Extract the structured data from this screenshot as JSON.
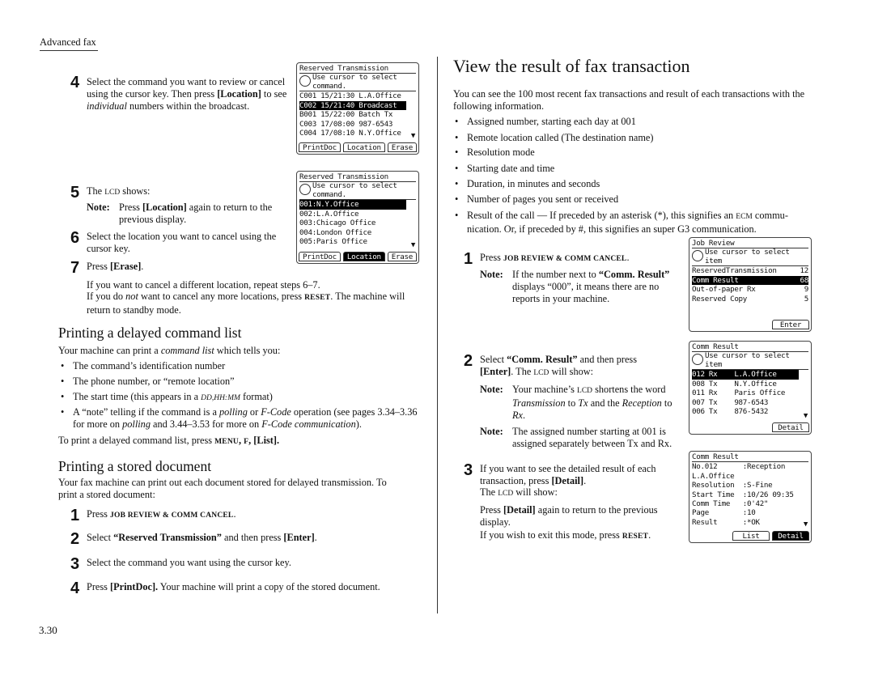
{
  "header": {
    "section": "Advanced fax",
    "page_number": "3.30"
  },
  "left": {
    "step4": {
      "num": "4",
      "text": [
        [
          "Select the command you want to review or can­cel using the cursor key. Then press ",
          ""
        ],
        [
          "[Location]",
          "b"
        ],
        [
          " to see ",
          ""
        ],
        [
          "individual",
          "i"
        ],
        [
          " numbers within the broad­cast.",
          ""
        ]
      ]
    },
    "step5": {
      "num": "5",
      "text": [
        [
          "The ",
          ""
        ],
        [
          "LCD",
          "scn"
        ],
        [
          " shows:",
          ""
        ]
      ]
    },
    "note5": {
      "label": "Note:",
      "text": [
        [
          "Press ",
          ""
        ],
        [
          "[Location]",
          "b"
        ],
        [
          " again to return to the previous display.",
          ""
        ]
      ]
    },
    "step6": {
      "num": "6",
      "text": [
        [
          "Select the location you want to cancel using the cursor key.",
          ""
        ]
      ]
    },
    "step7": {
      "num": "7",
      "text": [
        [
          "Press ",
          ""
        ],
        [
          "[Erase]",
          "b"
        ],
        [
          ".",
          ""
        ]
      ]
    },
    "after7": [
      [
        [
          "If you want to cancel a different location, repeat steps 6–7.",
          ""
        ]
      ],
      [
        [
          "If you do ",
          ""
        ],
        [
          "not",
          "i"
        ],
        [
          " want to cancel any more locations, press ",
          ""
        ],
        [
          "RESET",
          "sc"
        ],
        [
          ". The machine will return to standby mode.",
          ""
        ]
      ]
    ],
    "sec1": {
      "heading": "Printing a delayed command list",
      "intro": [
        [
          "Your machine can print a ",
          ""
        ],
        [
          "command list",
          "i"
        ],
        [
          " which tells you:",
          ""
        ]
      ],
      "bullets": [
        [
          [
            "The command’s identification number",
            ""
          ]
        ],
        [
          [
            "The phone number, or “remote location”",
            ""
          ]
        ],
        [
          [
            "The start time (this appears in a ",
            ""
          ],
          [
            "DD,HH:MM",
            "i scn"
          ],
          [
            " format)",
            ""
          ]
        ],
        [
          [
            "A “note” telling if the command is a ",
            ""
          ],
          [
            "polling",
            "i"
          ],
          [
            " or ",
            ""
          ],
          [
            "F-Code",
            "i"
          ],
          [
            " operation (see pages 3.34–3.36 for more on ",
            ""
          ],
          [
            "polling",
            "i"
          ],
          [
            " and 3.44–3.53 for more on ",
            ""
          ],
          [
            "F-Code communication",
            "i"
          ],
          [
            ").",
            ""
          ]
        ]
      ],
      "outro": [
        [
          "To print a delayed command list, press ",
          ""
        ],
        [
          "MENU",
          "sc"
        ],
        [
          ", ",
          "b"
        ],
        [
          "F",
          "sc"
        ],
        [
          ", [List].",
          "b"
        ]
      ]
    },
    "sec2": {
      "heading": "Printing a stored document",
      "intro": [
        [
          "Your fax machine can print out each document stored for delayed transmission. To print a stored document:",
          ""
        ]
      ],
      "steps": [
        {
          "num": "1",
          "text": [
            [
              "Press ",
              ""
            ],
            [
              "JOB REVIEW & COMM CANCEL",
              "sc"
            ],
            [
              ".",
              ""
            ]
          ]
        },
        {
          "num": "2",
          "text": [
            [
              "Select ",
              ""
            ],
            [
              "“Reserved Transmission”",
              "b"
            ],
            [
              " and then press ",
              ""
            ],
            [
              "[Enter]",
              "b"
            ],
            [
              ".",
              ""
            ]
          ]
        },
        {
          "num": "3",
          "text": [
            [
              "Select the command you want using the cursor key.",
              ""
            ]
          ]
        },
        {
          "num": "4",
          "text": [
            [
              "Press ",
              ""
            ],
            [
              "[PrintDoc].",
              "b"
            ],
            [
              " Your machine will print a copy of the stored document.",
              ""
            ]
          ]
        }
      ]
    }
  },
  "right": {
    "title": "View the result of fax transaction",
    "intro": [
      [
        "You can see the 100 most recent fax transactions and result of each transactions with the following information.",
        ""
      ]
    ],
    "bullets": [
      [
        [
          "Assigned number, starting each day at 001",
          ""
        ]
      ],
      [
        [
          "Remote location called (The destination name)",
          ""
        ]
      ],
      [
        [
          "Resolution mode",
          ""
        ]
      ],
      [
        [
          "Starting date and time",
          ""
        ]
      ],
      [
        [
          "Duration, in minutes and seconds",
          ""
        ]
      ],
      [
        [
          "Number of pages you sent or received",
          ""
        ]
      ],
      [
        [
          "Result of the call — If preceded by an asterisk (*), this signifies an ",
          ""
        ],
        [
          "ECM",
          "scn"
        ],
        [
          " commu­nication. Or, if preceded by #, this signifies an super G3 communication.",
          ""
        ]
      ]
    ],
    "step1": {
      "num": "1",
      "text": [
        [
          "Press ",
          ""
        ],
        [
          "JOB REVIEW & COMM CANCEL",
          "sc"
        ],
        [
          ".",
          ""
        ]
      ]
    },
    "note1": {
      "label": "Note:",
      "text": [
        [
          "If the number next to ",
          ""
        ],
        [
          "“Comm. Result”",
          "b"
        ],
        [
          " displays “000”, it means there are no reports in your machine.",
          ""
        ]
      ]
    },
    "step2": {
      "num": "2",
      "text": [
        [
          "Select ",
          ""
        ],
        [
          "“Comm. Result”",
          "b"
        ],
        [
          " and then press ",
          ""
        ],
        [
          "[Enter]",
          "b"
        ],
        [
          ". The ",
          ""
        ],
        [
          "LCD",
          "scn"
        ],
        [
          " will show:",
          ""
        ]
      ]
    },
    "note2a": {
      "label": "Note:",
      "text": [
        [
          "Your machine’s ",
          ""
        ],
        [
          "LCD",
          "scn"
        ],
        [
          " shortens the word ",
          ""
        ],
        [
          "Transmission",
          "i"
        ],
        [
          " to ",
          ""
        ],
        [
          "Tx",
          "i"
        ],
        [
          " and the ",
          ""
        ],
        [
          "Reception",
          "i"
        ],
        [
          " to ",
          ""
        ],
        [
          "Rx",
          "i"
        ],
        [
          ".",
          ""
        ]
      ]
    },
    "note2b": {
      "label": "Note:",
      "text": [
        [
          "The assigned number starting at 001 is assigned separately between Tx and Rx.",
          ""
        ]
      ]
    },
    "step3": {
      "num": "3",
      "text": [
        [
          "If you want to see the detailed result of each transaction, press ",
          ""
        ],
        [
          "[Detail]",
          "b"
        ],
        [
          ".",
          ""
        ]
      ]
    },
    "step3b": [
      [
        "The ",
        ""
      ],
      [
        "LCD",
        "scn"
      ],
      [
        " will show:",
        ""
      ]
    ],
    "step3c": [
      [
        "Press ",
        ""
      ],
      [
        "[Detail]",
        "b"
      ],
      [
        " again to return to the previous display.",
        ""
      ]
    ],
    "step3d": [
      [
        "If you wish to exit this mode, press ",
        ""
      ],
      [
        "RESET",
        "sc"
      ],
      [
        ".",
        ""
      ]
    ]
  },
  "lcds": {
    "reserved1": {
      "title": "Reserved Transmission",
      "help": [
        "Use cursor to select",
        "command."
      ],
      "rows": [
        [
          "C001 15/21:30 L.A.Office",
          ""
        ],
        [
          "C002 15/21:40 Broadcast",
          ""
        ],
        [
          "B001 15/22:00 Batch Tx",
          ""
        ],
        [
          "C003 17/08:00 987-6543",
          ""
        ],
        [
          "C004 17/08:10 N.Y.Office",
          ""
        ]
      ],
      "selected": 1,
      "more": "▼",
      "buttons": [
        "PrintDoc",
        "Location",
        "Erase"
      ],
      "active_button": -1
    },
    "reserved2": {
      "title": "Reserved Transmission",
      "help": [
        "Use cursor to select",
        "command."
      ],
      "rows": [
        [
          "001:N.Y.Office",
          ""
        ],
        [
          "002:L.A.Office",
          ""
        ],
        [
          "003:Chicago Office",
          ""
        ],
        [
          "004:London Office",
          ""
        ],
        [
          "005:Paris Office",
          ""
        ]
      ],
      "selected": 0,
      "more": "▼",
      "buttons": [
        "PrintDoc",
        "Location",
        "Erase"
      ],
      "active_button": 1
    },
    "jobreview": {
      "title": "Job Review",
      "help": [
        "Use cursor to select",
        "item"
      ],
      "rows": [
        [
          "ReservedTransmission",
          "12"
        ],
        [
          "Comm Result",
          "68"
        ],
        [
          "Out-of-paper Rx",
          "9"
        ],
        [
          "Reserved Copy",
          "5"
        ]
      ],
      "selected": 1,
      "buttons": [
        "Enter"
      ],
      "active_button": -1
    },
    "commresult": {
      "title": "Comm Result",
      "help": [
        "Use cursor to select",
        "item"
      ],
      "rows": [
        [
          "012 Rx    L.A.Office",
          ""
        ],
        [
          "008 Tx    N.Y.Office",
          ""
        ],
        [
          "011 Rx    Paris Office",
          ""
        ],
        [
          "007 Tx    987-6543",
          ""
        ],
        [
          "006 Tx    876-5432",
          ""
        ]
      ],
      "selected": 0,
      "more": "▼",
      "buttons": [
        "Detail"
      ],
      "active_button": -1
    },
    "detail": {
      "title": "Comm Result",
      "rows": [
        [
          "No.012      :Reception",
          ""
        ],
        [
          "L.A.Office",
          ""
        ],
        [
          "Resolution  :S-Fine",
          ""
        ],
        [
          "Start Time  :10/26 09:35",
          ""
        ],
        [
          "Comm Time   :0'42\"",
          ""
        ],
        [
          "Page        :10",
          ""
        ],
        [
          "Result      :*OK",
          ""
        ]
      ],
      "selected": -1,
      "more": "▼",
      "buttons": [
        "List",
        "Detail"
      ],
      "active_button": 1
    }
  }
}
